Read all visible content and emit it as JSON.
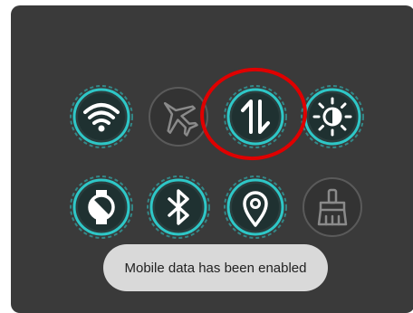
{
  "colors": {
    "panel_bg": "#3a3a3a",
    "active_ring": "#2ec7c7",
    "inactive_ring": "#5a5a5a",
    "highlight_ellipse": "#e00000",
    "toast_bg": "#d9d9d9"
  },
  "quick_settings": [
    {
      "id": "wifi",
      "icon": "wifi-icon",
      "state": "on"
    },
    {
      "id": "airplane",
      "icon": "airplane-icon",
      "state": "off"
    },
    {
      "id": "mobile-data",
      "icon": "mobile-data-icon",
      "state": "on"
    },
    {
      "id": "brightness",
      "icon": "brightness-icon",
      "state": "on"
    },
    {
      "id": "auto-rotate",
      "icon": "watch-icon",
      "state": "on"
    },
    {
      "id": "bluetooth",
      "icon": "bluetooth-icon",
      "state": "on"
    },
    {
      "id": "location",
      "icon": "location-icon",
      "state": "on"
    },
    {
      "id": "cleaner",
      "icon": "broom-icon",
      "state": "off"
    }
  ],
  "toast": {
    "message": "Mobile data has been enabled"
  }
}
